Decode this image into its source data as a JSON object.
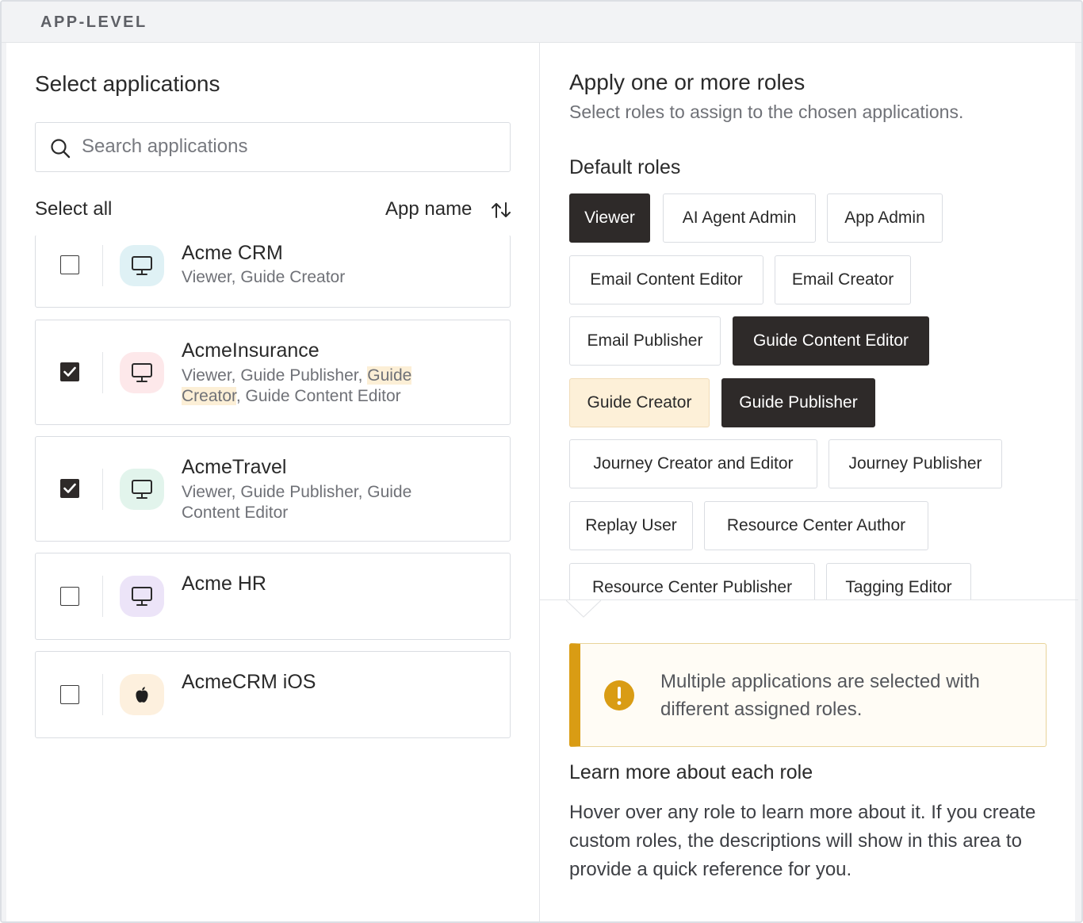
{
  "header": {
    "label": "APP-LEVEL"
  },
  "left": {
    "title": "Select applications",
    "search": {
      "placeholder": "Search applications",
      "value": ""
    },
    "select_all_label": "Select all",
    "sort_label": "App name",
    "apps": [
      {
        "name": "Acme CRM",
        "checked": false,
        "icon": "monitor-icon",
        "icon_bg": "#dff1f5",
        "roles_plain": "Viewer, Guide Creator",
        "roles_highlight": "",
        "roles_after": ""
      },
      {
        "name": "AcmeInsurance",
        "checked": true,
        "icon": "monitor-icon",
        "icon_bg": "#fde8ea",
        "roles_plain": "Viewer, Guide Publisher, ",
        "roles_highlight": "Guide Creator",
        "roles_after": ", Guide Content Editor"
      },
      {
        "name": "AcmeTravel",
        "checked": true,
        "icon": "monitor-icon",
        "icon_bg": "#e2f4ec",
        "roles_plain": "Viewer, Guide Publisher, Guide Content Editor",
        "roles_highlight": "",
        "roles_after": ""
      },
      {
        "name": "Acme HR",
        "checked": false,
        "icon": "monitor-icon",
        "icon_bg": "#ece4f8",
        "roles_plain": "",
        "roles_highlight": "",
        "roles_after": ""
      },
      {
        "name": "AcmeCRM iOS",
        "checked": false,
        "icon": "apple-icon",
        "icon_bg": "#fdf0de",
        "roles_plain": "",
        "roles_highlight": "",
        "roles_after": ""
      }
    ]
  },
  "right": {
    "title": "Apply one or more roles",
    "subtitle": "Select roles to assign to the chosen applications.",
    "default_roles_title": "Default roles",
    "roles": [
      {
        "label": "Viewer",
        "state": "selected"
      },
      {
        "label": "AI Agent Admin",
        "state": "default"
      },
      {
        "label": "App Admin",
        "state": "default"
      },
      {
        "label": "Email Content Editor",
        "state": "default"
      },
      {
        "label": "Email Creator",
        "state": "default"
      },
      {
        "label": "Email Publisher",
        "state": "default"
      },
      {
        "label": "Guide Content Editor",
        "state": "selected"
      },
      {
        "label": "Guide Creator",
        "state": "hovered"
      },
      {
        "label": "Guide Publisher",
        "state": "selected"
      },
      {
        "label": "Journey Creator and Editor",
        "state": "default"
      },
      {
        "label": "Journey Publisher",
        "state": "default"
      },
      {
        "label": "Replay User",
        "state": "default"
      },
      {
        "label": "Resource Center Author",
        "state": "default"
      },
      {
        "label": "Resource Center Publisher",
        "state": "default"
      },
      {
        "label": "Tagging Editor",
        "state": "default"
      }
    ],
    "warning": {
      "text": "Multiple applications are selected with different assigned roles.",
      "icon": "exclamation-icon",
      "accent": "#d99c14"
    },
    "learn_title": "Learn more about each role",
    "learn_body": "Hover over any role to learn more about it. If you create custom roles, the descriptions will show in this area to provide a quick reference for you."
  },
  "colors": {
    "selected": "#2e2a29",
    "hovered": "#fdf0d8",
    "border": "#dadde2"
  }
}
